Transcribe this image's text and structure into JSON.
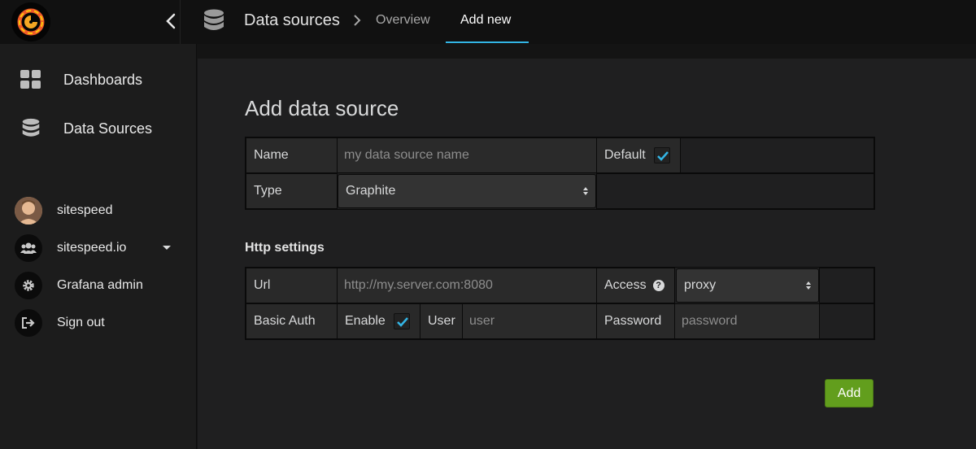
{
  "topbar": {
    "breadcrumb_title": "Data sources",
    "tabs": [
      {
        "label": "Overview"
      },
      {
        "label": "Add new"
      }
    ],
    "accent_color": "#33b5e5"
  },
  "sidebar": {
    "items": [
      {
        "label": "Dashboards",
        "icon": "grid-icon"
      },
      {
        "label": "Data Sources",
        "icon": "database-icon"
      }
    ],
    "user_items": [
      {
        "label": "sitespeed",
        "icon": "avatar"
      },
      {
        "label": "sitespeed.io",
        "icon": "users-icon"
      },
      {
        "label": "Grafana admin",
        "icon": "gear-icon"
      },
      {
        "label": "Sign out",
        "icon": "sign-out-icon"
      }
    ]
  },
  "main": {
    "title": "Add data source",
    "form": {
      "name_label": "Name",
      "name_placeholder": "my data source name",
      "default_label": "Default",
      "default_checked": true,
      "type_label": "Type",
      "type_value": "Graphite"
    },
    "http": {
      "section_title": "Http settings",
      "url_label": "Url",
      "url_placeholder": "http://my.server.com:8080",
      "access_label": "Access",
      "access_help": "?",
      "access_value": "proxy",
      "basic_auth_label": "Basic Auth",
      "enable_label": "Enable",
      "enable_checked": true,
      "user_label": "User",
      "user_placeholder": "user",
      "password_label": "Password",
      "password_placeholder": "password"
    },
    "add_button": "Add",
    "button_color": "#629e1d"
  }
}
